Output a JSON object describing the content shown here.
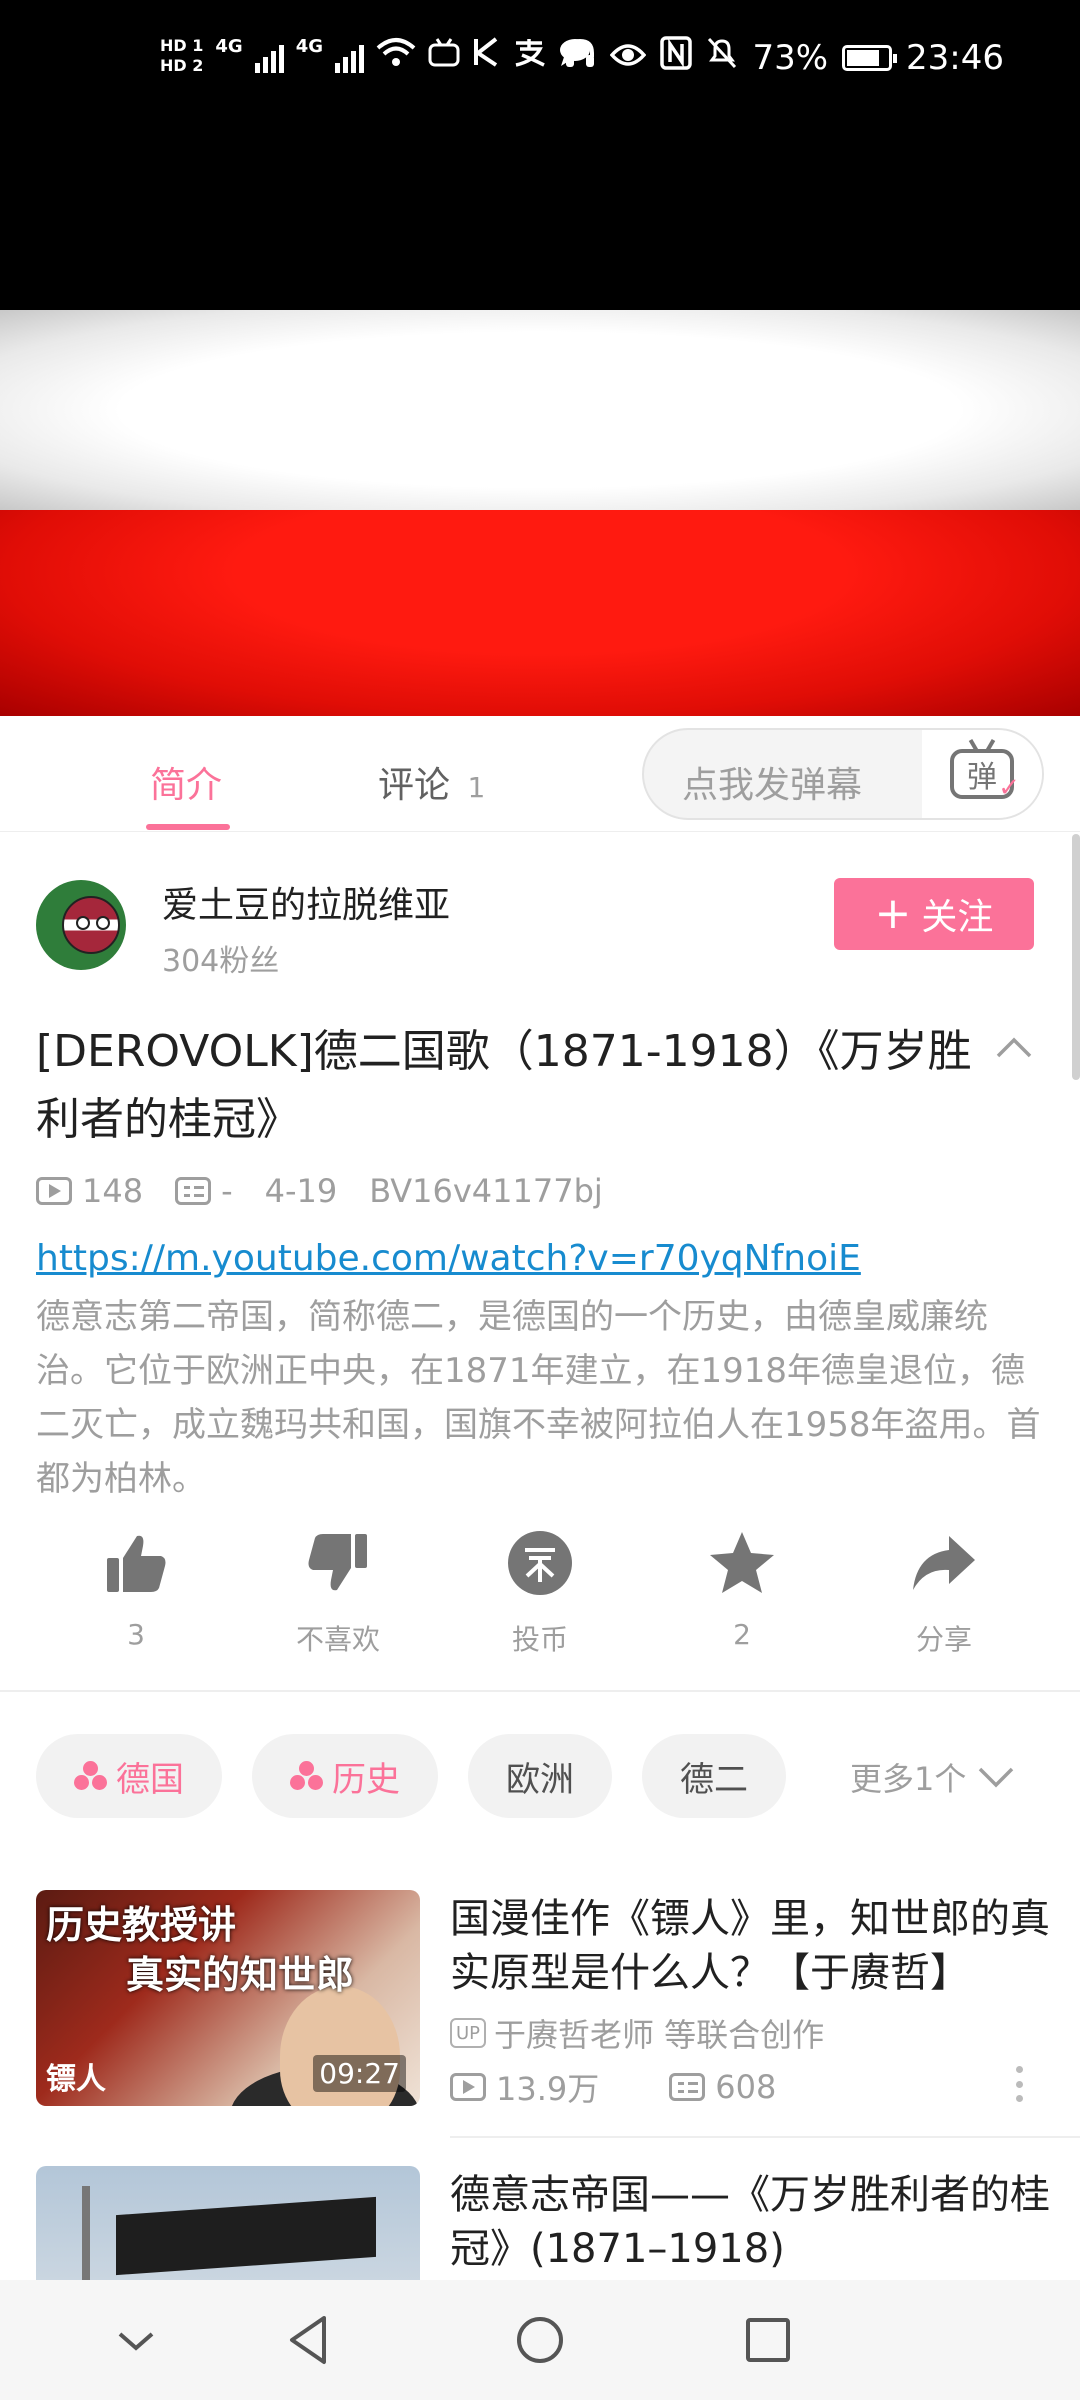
{
  "status_bar": {
    "hd1": "HD 1",
    "hd2": "HD 2",
    "net1": "4G",
    "net2": "4G",
    "battery": "73%",
    "time": "23:46",
    "icons": [
      "wifi-icon",
      "bilibili-icon",
      "k-icon",
      "alipay-icon",
      "chat-icon",
      "headset-icon",
      "eye-icon",
      "nfc-icon",
      "mute-icon",
      "battery-icon"
    ]
  },
  "video": {
    "flag_colors": [
      "#000000",
      "#ffffff",
      "#e00d06"
    ]
  },
  "tabs": {
    "intro": "简介",
    "comments": "评论",
    "comments_count": "1"
  },
  "danmaku": {
    "placeholder": "点我发弹幕",
    "button_glyph": "弹"
  },
  "uploader": {
    "name": "爱土豆的拉脱维亚",
    "fans": "304粉丝",
    "follow_label": "关注",
    "follow_glyph": "+"
  },
  "video_info": {
    "title": "[DEROVOLK]德二国歌（1871-1918）《万岁胜利者的桂冠》",
    "views": "148",
    "danmaku_count": "-",
    "date": "4-19",
    "bvid": "BV16v41177bj",
    "link": "https://m.youtube.com/watch?v=r70yqNfnoiE",
    "description": "德意志第二帝国，简称德二，是德国的一个历史，由德皇威廉统治。它位于欧洲正中央，在1871年建立，在1918年德皇退位，德二灭亡，成立魏玛共和国，国旗不幸被阿拉伯人在1958年盗用。首都为柏林。"
  },
  "actions": {
    "like": "3",
    "dislike": "不喜欢",
    "coin": "投币",
    "favorite": "2",
    "share": "分享"
  },
  "tags": {
    "items": [
      "德国",
      "历史",
      "欧洲",
      "德二"
    ],
    "more": "更多1个"
  },
  "related": [
    {
      "thumb_text_1": "历史教授讲",
      "thumb_text_2": "真实的知世郎",
      "thumb_text_3": "镖人",
      "duration": "09:27",
      "title": "国漫佳作《镖人》里，知世郎的真实原型是什么人？【于赓哲】",
      "up_badge": "UP",
      "author": "于赓哲老师 等联合创作",
      "views": "13.9万",
      "danmaku": "608"
    },
    {
      "title": "德意志帝国——《万岁胜利者的桂冠》(1871–1918)"
    }
  ],
  "accent_color": "#fb7299"
}
